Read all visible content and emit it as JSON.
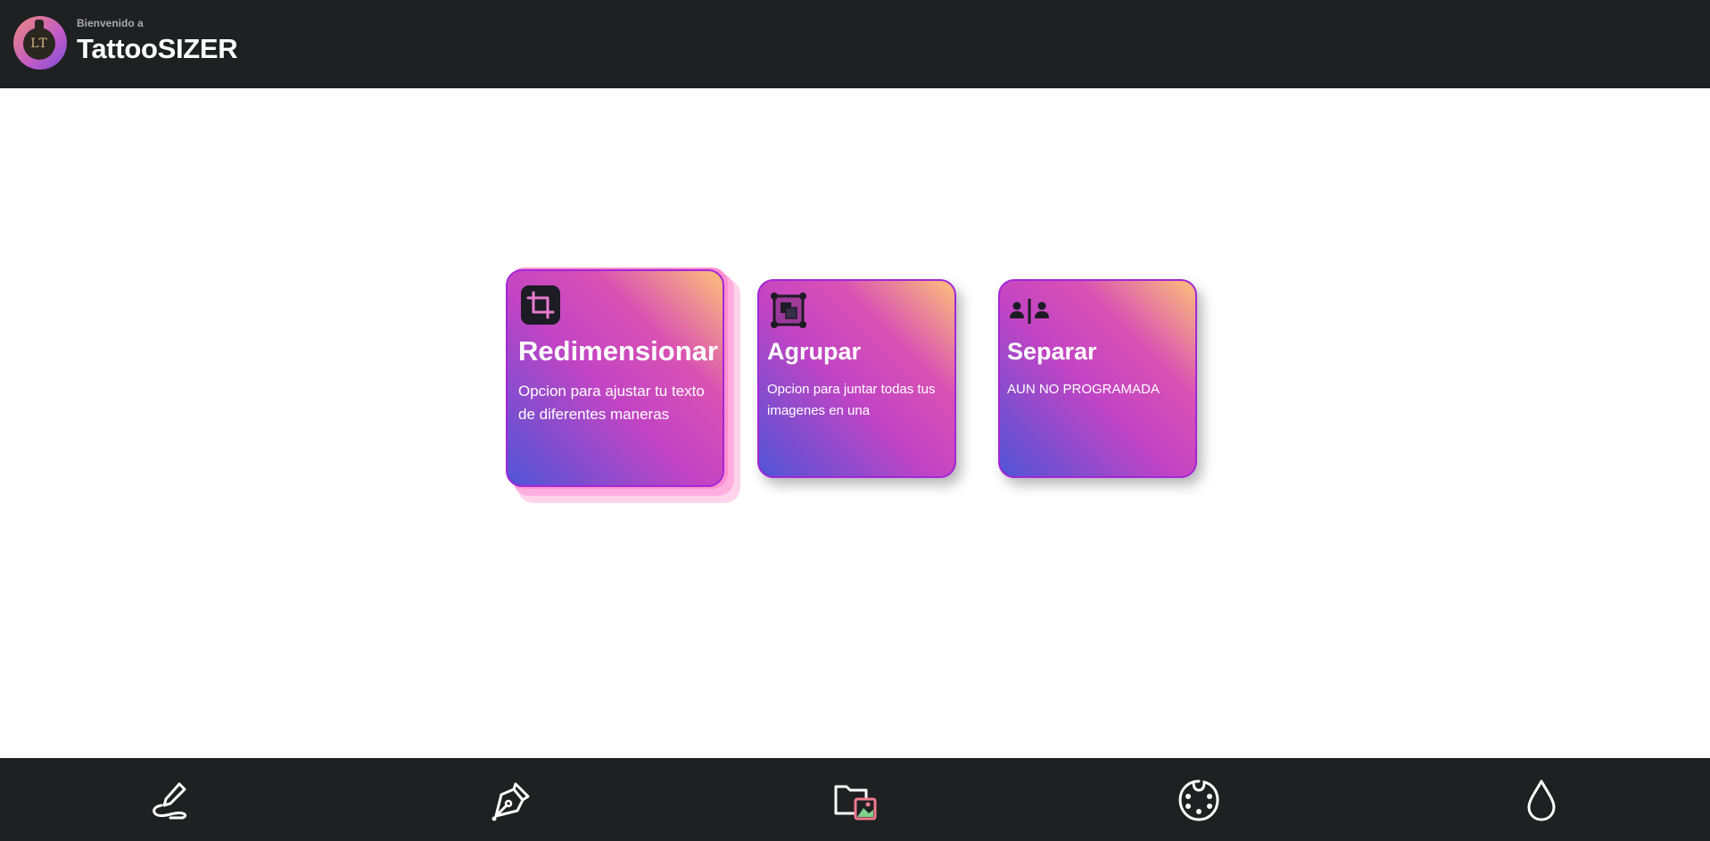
{
  "header": {
    "welcome": "Bienvenido a",
    "title": "TattooSIZER",
    "logo_text": "LT"
  },
  "cards": [
    {
      "title": "Redimensionar",
      "description": "Opcion para ajustar tu texto de diferentes maneras",
      "icon": "crop-icon"
    },
    {
      "title": "Agrupar",
      "description": "Opcion para juntar todas tus imagenes en una",
      "icon": "group-objects-icon"
    },
    {
      "title": "Separar",
      "description": "AUN NO PROGRAMADA",
      "icon": "split-people-icon"
    }
  ],
  "bottom_nav": {
    "items": [
      "signature-icon",
      "pen-nib-icon",
      "folder-image-icon",
      "palette-icon",
      "ink-drop-icon"
    ]
  },
  "colors": {
    "bar_background": "#1e2022",
    "card_border": "#a326d8",
    "gradient_start": "#4f55d6",
    "gradient_mid": "#c244c4",
    "gradient_end": "#fcc07a",
    "stack_pink": "#ff8fcf"
  }
}
